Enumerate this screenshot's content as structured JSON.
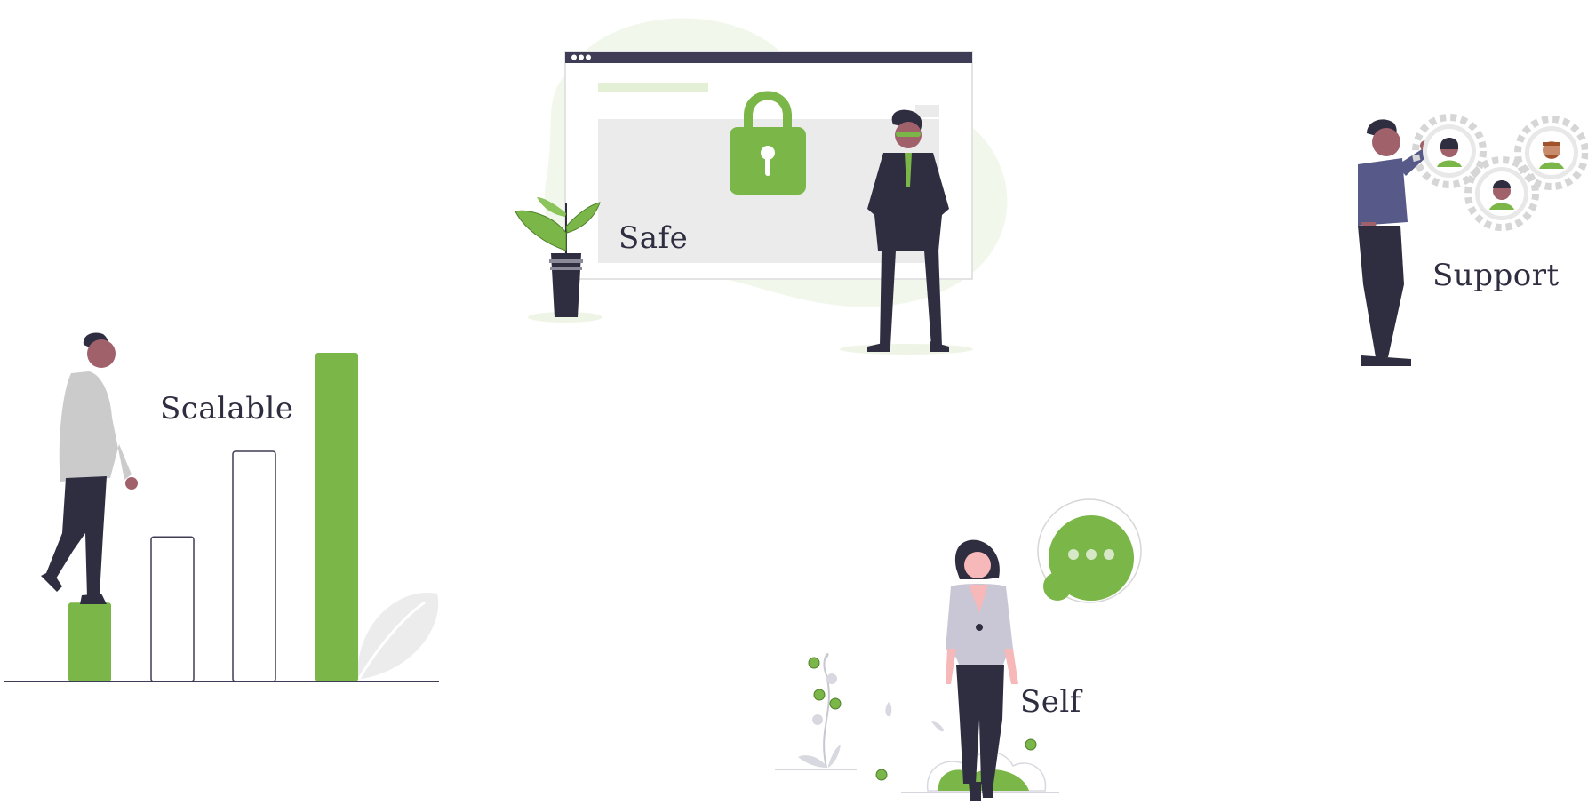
{
  "labels": {
    "safe": "Safe",
    "support": "Support",
    "scalable": "Scalable",
    "self": "Self"
  },
  "colors": {
    "accent": "#7ab648",
    "dark": "#2f2e41",
    "light_gray": "#ebebeb",
    "outline": "#3f3d56"
  },
  "icons": {
    "safe": [
      "browser-window-icon",
      "padlock-icon",
      "potted-plant-icon",
      "standing-man-figure"
    ],
    "support": [
      "man-touching-gears-figure",
      "gear-avatar-icon"
    ],
    "scalable": [
      "man-climbing-bars-figure",
      "bar-chart-icon",
      "leaf-icon"
    ],
    "self": [
      "woman-standing-figure",
      "chat-bubble-icon",
      "plant-icon"
    ]
  },
  "chart_data": {
    "type": "bar",
    "categories": [
      "",
      "",
      "",
      ""
    ],
    "values": [
      24,
      44,
      70,
      100
    ],
    "highlighted": [
      true,
      false,
      false,
      true
    ],
    "xlabel": "",
    "ylabel": "",
    "ylim": [
      0,
      100
    ],
    "grid": false
  }
}
